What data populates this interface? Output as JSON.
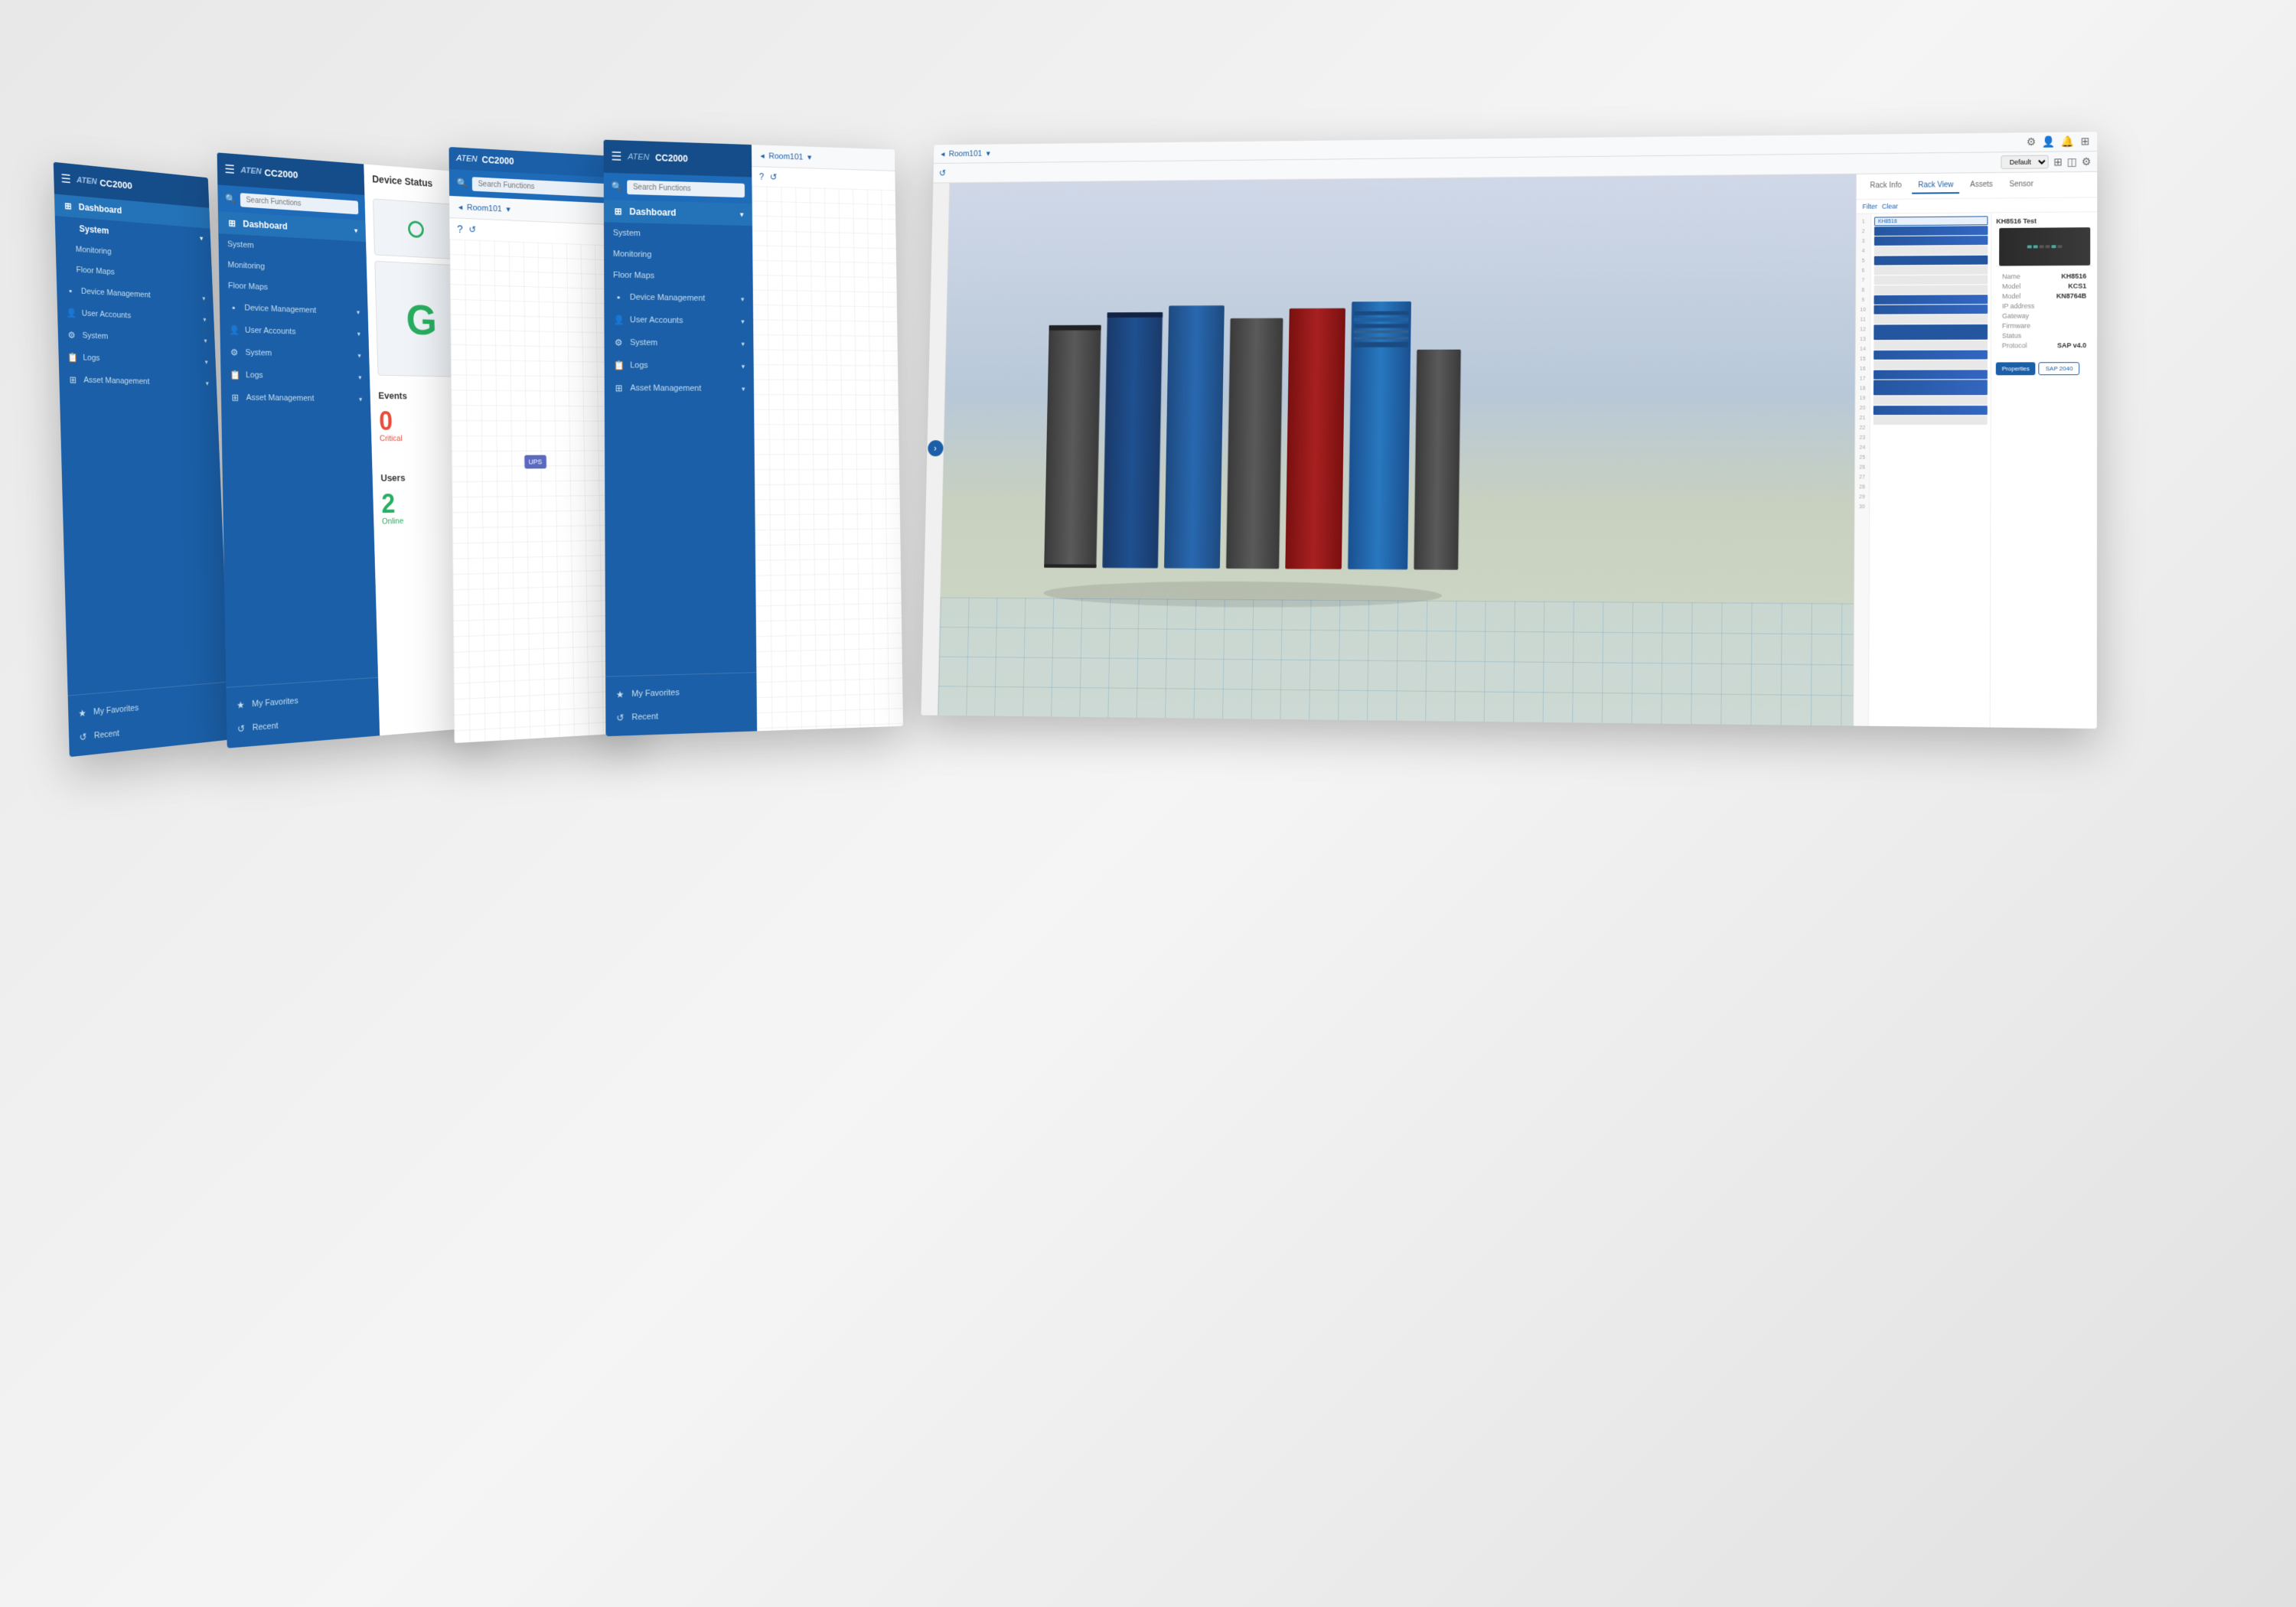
{
  "app": {
    "name": "ATEN CC2000",
    "brand": "ATEN",
    "product": "CC2000"
  },
  "panels": {
    "panel1": {
      "sidebar": {
        "nav_items": [
          {
            "label": "Dashboard",
            "icon": "⊞",
            "active": true,
            "indent": false
          },
          {
            "label": "System",
            "icon": "",
            "active": false,
            "indent": false,
            "parent": true,
            "has_arrow": true
          },
          {
            "label": "Monitoring",
            "icon": "",
            "active": false,
            "indent": true
          },
          {
            "label": "Floor Maps",
            "icon": "",
            "active": false,
            "indent": true
          },
          {
            "label": "Device Management",
            "icon": "▪",
            "active": false,
            "indent": false,
            "has_arrow": true
          },
          {
            "label": "User Accounts",
            "icon": "👤",
            "active": false,
            "indent": false,
            "has_arrow": true
          },
          {
            "label": "System",
            "icon": "⚙",
            "active": false,
            "indent": false,
            "has_arrow": true
          },
          {
            "label": "Logs",
            "icon": "📋",
            "active": false,
            "indent": false,
            "has_arrow": true
          },
          {
            "label": "Asset Management",
            "icon": "⊞",
            "active": false,
            "indent": false,
            "has_arrow": true
          }
        ],
        "footer_items": [
          {
            "label": "My Favorites",
            "icon": "★"
          },
          {
            "label": "Recent",
            "icon": "↺"
          }
        ]
      }
    },
    "panel2": {
      "search_placeholder": "Search Functions",
      "sidebar": {
        "nav_items": [
          {
            "label": "Dashboard",
            "icon": "⊞",
            "active": true
          },
          {
            "label": "System",
            "active": false,
            "has_arrow": true
          },
          {
            "label": "Monitoring",
            "active": false
          },
          {
            "label": "Floor Maps",
            "active": false
          },
          {
            "label": "Device Management",
            "active": false,
            "has_arrow": true
          },
          {
            "label": "User Accounts",
            "active": false,
            "has_arrow": true
          },
          {
            "label": "System",
            "active": false,
            "has_arrow": true
          },
          {
            "label": "Logs",
            "active": false,
            "has_arrow": true
          },
          {
            "label": "Asset Management",
            "active": false,
            "has_arrow": true
          }
        ],
        "footer_items": [
          {
            "label": "My Favorites",
            "icon": "★"
          },
          {
            "label": "Recent",
            "icon": "↺"
          }
        ]
      },
      "content": {
        "device_status_title": "Device Status",
        "events_title": "Events",
        "critical_count": "0",
        "critical_label": "Critical",
        "users_title": "Users",
        "online_count": "2",
        "online_label": "Online"
      }
    },
    "panel3": {
      "search_placeholder": "Search Functions",
      "breadcrumb": "Room101",
      "sidebar": {
        "nav_items": [
          {
            "label": "Dashboard",
            "active": true
          },
          {
            "label": "System",
            "has_arrow": true
          },
          {
            "label": "Monitoring"
          },
          {
            "label": "Floor Maps"
          },
          {
            "label": "Device Management",
            "has_arrow": true
          },
          {
            "label": "User Accounts",
            "has_arrow": true
          },
          {
            "label": "System",
            "has_arrow": true
          },
          {
            "label": "Logs",
            "has_arrow": true
          },
          {
            "label": "Asset Management",
            "has_arrow": true
          }
        ],
        "footer_items": [
          {
            "label": "My Favorites"
          },
          {
            "label": "Recent"
          }
        ]
      },
      "floor_map": {
        "ups_label": "UPS"
      }
    },
    "panel4": {
      "search_placeholder": "Search Functions",
      "breadcrumb": "Room101",
      "sidebar": {
        "nav_items": [
          {
            "label": "Dashboard",
            "active": true
          },
          {
            "label": "System",
            "has_arrow": true
          },
          {
            "label": "Monitoring"
          },
          {
            "label": "Floor Maps"
          },
          {
            "label": "Device Management",
            "has_arrow": true
          },
          {
            "label": "User Accounts",
            "has_arrow": true
          },
          {
            "label": "System",
            "has_arrow": true
          },
          {
            "label": "Logs",
            "has_arrow": true
          },
          {
            "label": "Asset Management",
            "has_arrow": true
          }
        ],
        "footer_items": [
          {
            "label": "My Favorites"
          },
          {
            "label": "Recent"
          }
        ]
      }
    },
    "panel5": {
      "breadcrumb": "Room101",
      "toolbar": {
        "select_default": "Default",
        "filter_label": "Filter",
        "reset_label": "Clear"
      },
      "rack_detail": {
        "tabs": [
          "Rack Info",
          "Rack View",
          "Assets",
          "Sensor"
        ],
        "active_tab": "Rack View",
        "device_name": "KH8516 Test",
        "device_info": [
          {
            "label": "Name",
            "value": "KH8516"
          },
          {
            "label": "Model",
            "value": "KCS1"
          },
          {
            "label": "Model",
            "value": "KN8764B"
          },
          {
            "label": "IP address",
            "value": ""
          },
          {
            "label": "Gateway",
            "value": ""
          },
          {
            "label": "Firmware version",
            "value": ""
          },
          {
            "label": "Status",
            "value": ""
          },
          {
            "label": "Protocol",
            "value": "SAP v4.0"
          }
        ],
        "action_btns": [
          "Properties",
          "SAP 2040"
        ]
      }
    }
  }
}
